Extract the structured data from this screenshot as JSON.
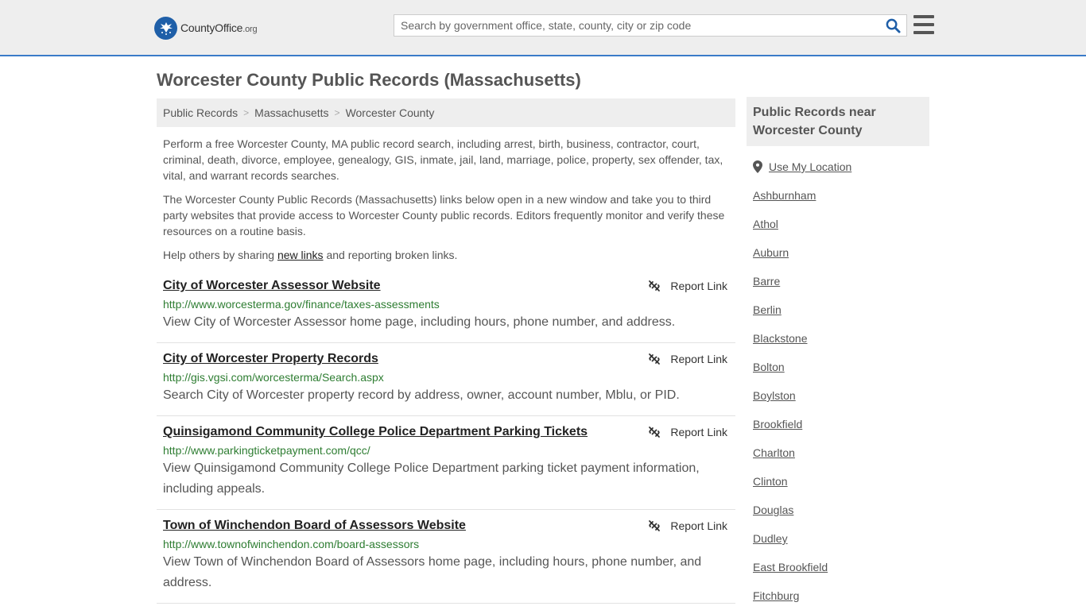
{
  "header": {
    "logo_main": "CountyOffice",
    "logo_tld": ".org",
    "search_placeholder": "Search by government office, state, county, city or zip code",
    "search_icon": "search-icon",
    "menu_icon": "hamburger-menu-icon",
    "accent_color": "#3a7bc8"
  },
  "page": {
    "title": "Worcester County Public Records (Massachusetts)"
  },
  "breadcrumb": [
    "Public Records",
    "Massachusetts",
    "Worcester County"
  ],
  "intro": {
    "p1": "Perform a free Worcester County, MA public record search, including arrest, birth, business, contractor, court, criminal, death, divorce, employee, genealogy, GIS, inmate, jail, land, marriage, police, property, sex offender, tax, vital, and warrant records searches.",
    "p2": "The Worcester County Public Records (Massachusetts) links below open in a new window and take you to third party websites that provide access to Worcester County public records. Editors frequently monitor and verify these resources on a routine basis.",
    "p3_before": "Help others by sharing ",
    "p3_link": "new links",
    "p3_after": " and reporting broken links."
  },
  "report_label": "Report Link",
  "records": [
    {
      "title": "City of Worcester Assessor Website",
      "url": "http://www.worcesterma.gov/finance/taxes-assessments",
      "desc": "View City of Worcester Assessor home page, including hours, phone number, and address."
    },
    {
      "title": "City of Worcester Property Records",
      "url": "http://gis.vgsi.com/worcesterma/Search.aspx",
      "desc": "Search City of Worcester property record by address, owner, account number, Mblu, or PID."
    },
    {
      "title": "Quinsigamond Community College Police Department Parking Tickets",
      "url": "http://www.parkingticketpayment.com/qcc/",
      "desc": "View Quinsigamond Community College Police Department parking ticket payment information, including appeals."
    },
    {
      "title": "Town of Winchendon Board of Assessors Website",
      "url": "http://www.townofwinchendon.com/board-assessors",
      "desc": "View Town of Winchendon Board of Assessors home page, including hours, phone number, and address."
    }
  ],
  "sidebar": {
    "heading": "Public Records near Worcester County",
    "use_location": "Use My Location",
    "towns": [
      "Ashburnham",
      "Athol",
      "Auburn",
      "Barre",
      "Berlin",
      "Blackstone",
      "Bolton",
      "Boylston",
      "Brookfield",
      "Charlton",
      "Clinton",
      "Douglas",
      "Dudley",
      "East Brookfield",
      "Fitchburg"
    ]
  }
}
